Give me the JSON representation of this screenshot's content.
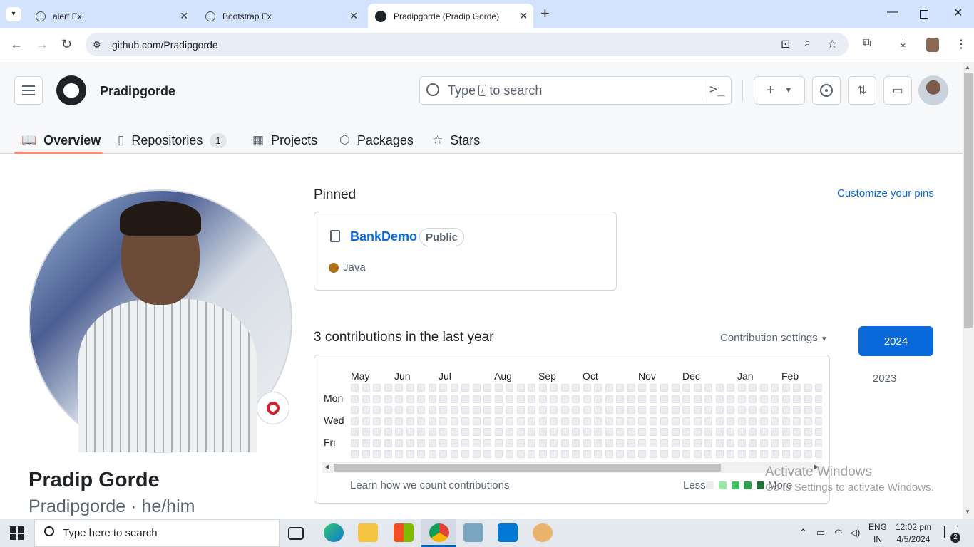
{
  "browser": {
    "tabs": [
      {
        "title": "alert Ex.",
        "active": false
      },
      {
        "title": "Bootstrap Ex.",
        "active": false
      },
      {
        "title": "Pradipgorde (Pradip Gorde)",
        "active": true
      }
    ],
    "url": "github.com/Pradipgorde"
  },
  "header": {
    "username": "Pradipgorde",
    "search_prefix": "Type",
    "search_key": "/",
    "search_suffix": "to search"
  },
  "nav": {
    "overview": "Overview",
    "repositories": "Repositories",
    "repositories_count": "1",
    "projects": "Projects",
    "packages": "Packages",
    "stars": "Stars"
  },
  "profile": {
    "full_name": "Pradip Gorde",
    "handle_line": "Pradipgorde · he/him"
  },
  "pinned": {
    "title": "Pinned",
    "customize_link": "Customize your pins",
    "repo": {
      "name": "BankDemo",
      "visibility": "Public",
      "language": "Java",
      "language_color": "#b07219"
    }
  },
  "contributions": {
    "title": "3 contributions in the last year",
    "settings": "Contribution settings",
    "months": [
      "May",
      "Jun",
      "Jul",
      "Aug",
      "Sep",
      "Oct",
      "Nov",
      "Dec",
      "Jan",
      "Feb"
    ],
    "days": [
      "Mon",
      "Wed",
      "Fri"
    ],
    "learn_link": "Learn how we count contributions",
    "legend_less": "Less",
    "legend_more": "More",
    "legend_colors": [
      "#ebedf0",
      "#9be9a8",
      "#40c463",
      "#30a14e",
      "#216e39"
    ],
    "years": [
      "2024",
      "2023"
    ],
    "selected_year": "2024"
  },
  "watermark": {
    "line1": "Activate Windows",
    "line2": "Go to Settings to activate Windows."
  },
  "taskbar": {
    "search_placeholder": "Type here to search",
    "lang_top": "ENG",
    "lang_bottom": "IN",
    "time": "12:02 pm",
    "date": "4/5/2024",
    "notification_count": "2"
  }
}
